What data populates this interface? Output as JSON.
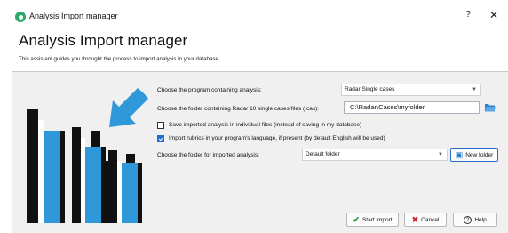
{
  "window": {
    "title": "Analysis Import manager",
    "help_glyph": "?",
    "close_glyph": "✕",
    "icon": "app-logo-icon"
  },
  "header": {
    "title": "Analysis Import manager",
    "subtitle": "This assistant guides you throught the process to import analysis in your database"
  },
  "form": {
    "program_label": "Choose the program containing analysis:",
    "program_value": "Radar Single cases",
    "folder_label": "Choose the folder containing Radar 10 single cases files (.cas):",
    "folder_value": "C:\\Radar\\Cases\\myfolder",
    "save_individual_label": "Save imported analysis in individual files (instead of saving in my database)",
    "save_individual_checked": false,
    "import_rubrics_label": "Import rubrics in your program's language, if present (by default English will be used)",
    "import_rubrics_checked": true,
    "target_folder_label": "Choose the folder for imported analysis:",
    "target_folder_value": "Default folder",
    "new_folder_label": "New folder"
  },
  "footer": {
    "start_label": "Start import",
    "cancel_label": "Cancel",
    "help_label": "Help"
  },
  "colors": {
    "accent_blue": "#2f98d8",
    "bar_black": "#111111",
    "content_bg": "#f0f0f0"
  }
}
